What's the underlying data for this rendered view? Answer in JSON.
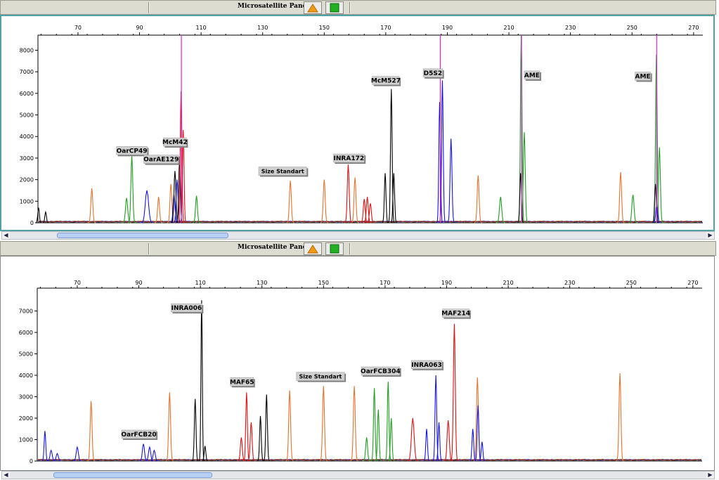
{
  "panels": [
    {
      "title": "Microsatellite Panel B",
      "colors": {
        "orange": "#e8722a",
        "green": "#1ea01e",
        "blue": "#1414e6",
        "black": "#000000",
        "red": "#e01010",
        "magenta": "#e020e0"
      },
      "chart_data": {
        "type": "line",
        "title": "Microsatellite Panel B",
        "xlim": [
          57,
          273
        ],
        "ylim": [
          0,
          8700
        ],
        "x_ticks": [
          70,
          90,
          110,
          130,
          150,
          170,
          190,
          210,
          230,
          250,
          270
        ],
        "y_ticks": [
          0,
          1000,
          2000,
          3000,
          4000,
          5000,
          6000,
          7000,
          8000
        ],
        "grid": false,
        "peaks": [
          {
            "series": "orange",
            "x": 74.5,
            "height": 1600,
            "width": 0.35
          },
          {
            "series": "orange",
            "x": 96.2,
            "height": 1200,
            "width": 0.35
          },
          {
            "series": "orange",
            "x": 100.2,
            "height": 1800,
            "width": 0.35
          },
          {
            "series": "orange",
            "x": 139.0,
            "height": 1950,
            "width": 0.35
          },
          {
            "series": "orange",
            "x": 150.0,
            "height": 2000,
            "width": 0.35
          },
          {
            "series": "orange",
            "x": 160.0,
            "height": 2100,
            "width": 0.35
          },
          {
            "series": "orange",
            "x": 200.0,
            "height": 2200,
            "width": 0.35
          },
          {
            "series": "orange",
            "x": 246.3,
            "height": 2350,
            "width": 0.35
          },
          {
            "series": "green",
            "x": 85.8,
            "height": 1150,
            "width": 0.4
          },
          {
            "series": "green",
            "x": 87.5,
            "height": 3100,
            "width": 0.35
          },
          {
            "series": "green",
            "x": 108.5,
            "height": 1250,
            "width": 0.35
          },
          {
            "series": "green",
            "x": 207.3,
            "height": 1200,
            "width": 0.4
          },
          {
            "series": "green",
            "x": 214.0,
            "height": 8700,
            "width": 0.3
          },
          {
            "series": "green",
            "x": 215.0,
            "height": 4200,
            "width": 0.35
          },
          {
            "series": "green",
            "x": 250.3,
            "height": 1300,
            "width": 0.4
          },
          {
            "series": "green",
            "x": 257.9,
            "height": 7800,
            "width": 0.3
          },
          {
            "series": "green",
            "x": 258.9,
            "height": 3500,
            "width": 0.35
          },
          {
            "series": "blue",
            "x": 92.4,
            "height": 1500,
            "width": 0.6
          },
          {
            "series": "blue",
            "x": 101.2,
            "height": 1300,
            "width": 0.35
          },
          {
            "series": "blue",
            "x": 102.2,
            "height": 2000,
            "width": 0.35
          },
          {
            "series": "blue",
            "x": 187.5,
            "height": 5600,
            "width": 0.3
          },
          {
            "series": "blue",
            "x": 188.4,
            "height": 6600,
            "width": 0.3
          },
          {
            "series": "blue",
            "x": 191.2,
            "height": 3900,
            "width": 0.35
          },
          {
            "series": "blue",
            "x": 258.0,
            "height": 800,
            "width": 0.35
          },
          {
            "series": "black",
            "x": 57.2,
            "height": 700,
            "width": 0.3
          },
          {
            "series": "black",
            "x": 59.5,
            "height": 500,
            "width": 0.3
          },
          {
            "series": "black",
            "x": 101.5,
            "height": 2400,
            "width": 0.35
          },
          {
            "series": "black",
            "x": 103.0,
            "height": 2900,
            "width": 0.3
          },
          {
            "series": "black",
            "x": 169.8,
            "height": 2300,
            "width": 0.3
          },
          {
            "series": "black",
            "x": 171.8,
            "height": 6200,
            "width": 0.3
          },
          {
            "series": "black",
            "x": 172.6,
            "height": 2300,
            "width": 0.3
          },
          {
            "series": "black",
            "x": 213.8,
            "height": 2300,
            "width": 0.3
          },
          {
            "series": "black",
            "x": 257.6,
            "height": 1800,
            "width": 0.3
          },
          {
            "series": "red",
            "x": 103.5,
            "height": 6100,
            "width": 0.3
          },
          {
            "series": "red",
            "x": 104.2,
            "height": 4300,
            "width": 0.3
          },
          {
            "series": "red",
            "x": 157.8,
            "height": 2700,
            "width": 0.35
          },
          {
            "series": "red",
            "x": 163.0,
            "height": 1100,
            "width": 0.35
          },
          {
            "series": "red",
            "x": 164.0,
            "height": 1200,
            "width": 0.35
          },
          {
            "series": "red",
            "x": 165.0,
            "height": 900,
            "width": 0.35
          }
        ],
        "markers": [
          {
            "series": "magenta",
            "x": 103.6,
            "height": 8700
          },
          {
            "series": "magenta",
            "x": 187.7,
            "height": 8700
          },
          {
            "series": "magenta",
            "x": 214.1,
            "height": 8700
          },
          {
            "series": "magenta",
            "x": 258.0,
            "height": 8700
          }
        ],
        "annotations": [
          {
            "text": "OarCP49",
            "x": 87.5,
            "y": 3150
          },
          {
            "text": "McM42",
            "x": 101.5,
            "y": 3550
          },
          {
            "text": "OarAE129",
            "x": 97.0,
            "y": 2750
          },
          {
            "text": "Size Standart",
            "x": 136.5,
            "y": 2200
          },
          {
            "text": "INRA172",
            "x": 158.0,
            "y": 2800
          },
          {
            "text": "McM527",
            "x": 170.0,
            "y": 6400
          },
          {
            "text": "D5S2",
            "x": 185.3,
            "y": 6750
          },
          {
            "text": "AME",
            "x": 217.5,
            "y": 6650
          },
          {
            "text": "AME",
            "x": 253.5,
            "y": 6600
          }
        ]
      }
    },
    {
      "title": "Microsatellite Panel A",
      "colors": {
        "orange": "#e8722a",
        "green": "#1ea01e",
        "blue": "#1414e6",
        "black": "#000000",
        "red": "#e01010",
        "magenta": "#e020e0"
      },
      "chart_data": {
        "type": "line",
        "title": "Microsatellite Panel A",
        "xlim": [
          57,
          273
        ],
        "ylim": [
          0,
          8000
        ],
        "x_ticks": [
          70,
          90,
          110,
          130,
          150,
          170,
          190,
          210,
          230,
          250,
          270
        ],
        "y_ticks": [
          0,
          1000,
          2000,
          3000,
          4000,
          5000,
          6000,
          7000
        ],
        "grid": false,
        "peaks": [
          {
            "series": "orange",
            "x": 74.5,
            "height": 2800,
            "width": 0.35
          },
          {
            "series": "orange",
            "x": 100.0,
            "height": 3200,
            "width": 0.35
          },
          {
            "series": "orange",
            "x": 139.0,
            "height": 3300,
            "width": 0.35
          },
          {
            "series": "orange",
            "x": 150.0,
            "height": 3500,
            "width": 0.35
          },
          {
            "series": "orange",
            "x": 160.0,
            "height": 3500,
            "width": 0.35
          },
          {
            "series": "orange",
            "x": 200.0,
            "height": 3900,
            "width": 0.35
          },
          {
            "series": "orange",
            "x": 246.3,
            "height": 4100,
            "width": 0.35
          },
          {
            "series": "green",
            "x": 164.0,
            "height": 1100,
            "width": 0.35
          },
          {
            "series": "green",
            "x": 166.5,
            "height": 3400,
            "width": 0.3
          },
          {
            "series": "green",
            "x": 167.8,
            "height": 2400,
            "width": 0.3
          },
          {
            "series": "green",
            "x": 171.0,
            "height": 3700,
            "width": 0.3
          },
          {
            "series": "green",
            "x": 172.0,
            "height": 2000,
            "width": 0.3
          },
          {
            "series": "blue",
            "x": 59.5,
            "height": 1400,
            "width": 0.3
          },
          {
            "series": "blue",
            "x": 61.5,
            "height": 500,
            "width": 0.4
          },
          {
            "series": "blue",
            "x": 63.5,
            "height": 350,
            "width": 0.4
          },
          {
            "series": "blue",
            "x": 70.0,
            "height": 650,
            "width": 0.4
          },
          {
            "series": "blue",
            "x": 91.5,
            "height": 800,
            "width": 0.4
          },
          {
            "series": "blue",
            "x": 93.5,
            "height": 650,
            "width": 0.4
          },
          {
            "series": "blue",
            "x": 95.0,
            "height": 500,
            "width": 0.4
          },
          {
            "series": "blue",
            "x": 183.5,
            "height": 1500,
            "width": 0.3
          },
          {
            "series": "blue",
            "x": 186.5,
            "height": 4000,
            "width": 0.3
          },
          {
            "series": "blue",
            "x": 187.5,
            "height": 1800,
            "width": 0.3
          },
          {
            "series": "blue",
            "x": 198.5,
            "height": 1500,
            "width": 0.3
          },
          {
            "series": "blue",
            "x": 200.2,
            "height": 2600,
            "width": 0.3
          },
          {
            "series": "blue",
            "x": 201.5,
            "height": 900,
            "width": 0.3
          },
          {
            "series": "black",
            "x": 108.3,
            "height": 2900,
            "width": 0.3
          },
          {
            "series": "black",
            "x": 110.4,
            "height": 7500,
            "width": 0.25
          },
          {
            "series": "black",
            "x": 111.5,
            "height": 700,
            "width": 0.3
          },
          {
            "series": "black",
            "x": 129.5,
            "height": 2100,
            "width": 0.3
          },
          {
            "series": "black",
            "x": 131.5,
            "height": 3100,
            "width": 0.3
          },
          {
            "series": "red",
            "x": 123.3,
            "height": 1100,
            "width": 0.35
          },
          {
            "series": "red",
            "x": 125.0,
            "height": 3200,
            "width": 0.3
          },
          {
            "series": "red",
            "x": 126.5,
            "height": 1800,
            "width": 0.35
          },
          {
            "series": "red",
            "x": 179.0,
            "height": 2000,
            "width": 0.5
          },
          {
            "series": "red",
            "x": 190.5,
            "height": 1900,
            "width": 0.4
          },
          {
            "series": "red",
            "x": 192.5,
            "height": 6400,
            "width": 0.35
          }
        ],
        "markers": [],
        "annotations": [
          {
            "text": "OarFCB20",
            "x": 90.0,
            "y": 1050
          },
          {
            "text": "INRA006",
            "x": 105.5,
            "y": 6950
          },
          {
            "text": "MAF65",
            "x": 123.5,
            "y": 3500
          },
          {
            "text": "Size Standart",
            "x": 149.0,
            "y": 3750
          },
          {
            "text": "OarFCB304",
            "x": 168.5,
            "y": 4000
          },
          {
            "text": "INRA063",
            "x": 183.5,
            "y": 4300
          },
          {
            "text": "MAF214",
            "x": 193.0,
            "y": 6700
          }
        ]
      }
    }
  ]
}
